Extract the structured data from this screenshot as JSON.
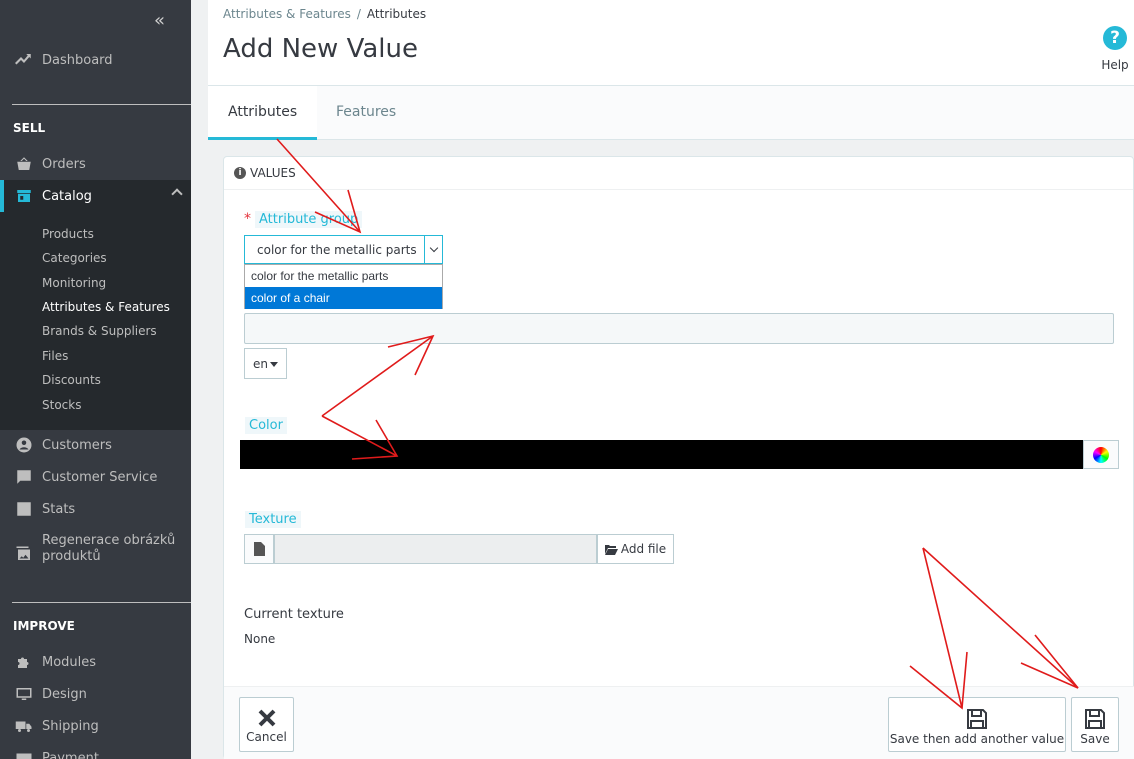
{
  "sidebar": {
    "collapse_glyph": "«",
    "dashboard": "Dashboard",
    "sell_title": "SELL",
    "orders": "Orders",
    "catalog": "Catalog",
    "catalog_sub": [
      "Products",
      "Categories",
      "Monitoring",
      "Attributes & Features",
      "Brands & Suppliers",
      "Files",
      "Discounts",
      "Stocks"
    ],
    "customers": "Customers",
    "customer_service": "Customer Service",
    "stats": "Stats",
    "regen_line1": "Regenerace obrázků",
    "regen_line2": "produktů",
    "improve_title": "IMPROVE",
    "modules": "Modules",
    "design": "Design",
    "shipping": "Shipping",
    "payment": "Payment"
  },
  "header": {
    "breadcrumb_parent": "Attributes & Features",
    "breadcrumb_sep": "/",
    "breadcrumb_current": "Attributes",
    "title": "Add New Value",
    "help_label": "Help",
    "help_glyph": "?"
  },
  "tabs": [
    "Attributes",
    "Features"
  ],
  "panel": {
    "heading": "VALUES",
    "attribute_group_label": "Attribute group",
    "required_mark": "*",
    "select_value": "color for the metallic parts",
    "options": [
      "color for the metallic parts",
      "color of a chair"
    ],
    "lang": "en",
    "color_label": "Color",
    "texture_label": "Texture",
    "add_file": "Add file",
    "current_texture_label": "Current texture",
    "current_texture_value": "None"
  },
  "footer": {
    "cancel": "Cancel",
    "save_another": "Save then add another value",
    "save": "Save"
  },
  "colors": {
    "sidebar_bg": "#363a41",
    "accent": "#25b9d7",
    "annotation": "#e01b1b",
    "selected_option": "#0078d7"
  }
}
